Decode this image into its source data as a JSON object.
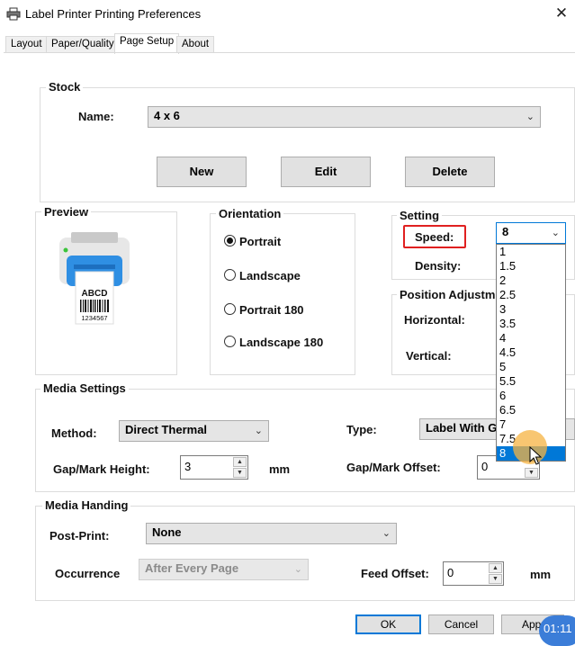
{
  "window": {
    "title": "Label Printer Printing Preferences",
    "close_glyph": "✕"
  },
  "tabs": [
    {
      "label": "Layout"
    },
    {
      "label": "Paper/Quality"
    },
    {
      "label": "Page Setup"
    },
    {
      "label": "About"
    }
  ],
  "active_tab": "Page Setup",
  "stock": {
    "title": "Stock",
    "name_label": "Name:",
    "name_value": "4 x 6",
    "buttons": {
      "new": "New",
      "edit": "Edit",
      "delete": "Delete"
    }
  },
  "preview": {
    "title": "Preview",
    "label_text": "ABCD",
    "label_number": "1234567"
  },
  "orientation": {
    "title": "Orientation",
    "options": [
      "Portrait",
      "Landscape",
      "Portrait 180",
      "Landscape 180"
    ],
    "selected": "Portrait"
  },
  "setting": {
    "title": "Setting",
    "speed_label": "Speed:",
    "speed_value": "8",
    "density_label": "Density:",
    "speed_options": [
      "1",
      "1.5",
      "2",
      "2.5",
      "3",
      "3.5",
      "4",
      "4.5",
      "5",
      "5.5",
      "6",
      "6.5",
      "7",
      "7.5",
      "8"
    ],
    "speed_selected": "8"
  },
  "position": {
    "title": "Position Adjustm",
    "horizontal_label": "Horizontal:",
    "vertical_label": "Vertical:"
  },
  "media_settings": {
    "title": "Media Settings",
    "method_label": "Method:",
    "method_value": "Direct Thermal",
    "type_label": "Type:",
    "type_value": "Label With G",
    "gap_height_label": "Gap/Mark Height:",
    "gap_height_value": "3",
    "gap_height_unit": "mm",
    "gap_offset_label": "Gap/Mark Offset:",
    "gap_offset_value": "0"
  },
  "media_handling": {
    "title": "Media Handing",
    "post_print_label": "Post-Print:",
    "post_print_value": "None",
    "occurrence_label": "Occurrence",
    "occurrence_value": "After Every Page",
    "feed_offset_label": "Feed Offset:",
    "feed_offset_value": "0",
    "feed_offset_unit": "mm"
  },
  "footer": {
    "ok": "OK",
    "cancel": "Cancel",
    "apply": "App"
  },
  "overlay": {
    "timer": "01:11"
  },
  "colors": {
    "accent": "#0078d7",
    "highlight": "#e02020",
    "cursor_halo": "#f5b342",
    "timer_badge": "#3b7dd8"
  }
}
